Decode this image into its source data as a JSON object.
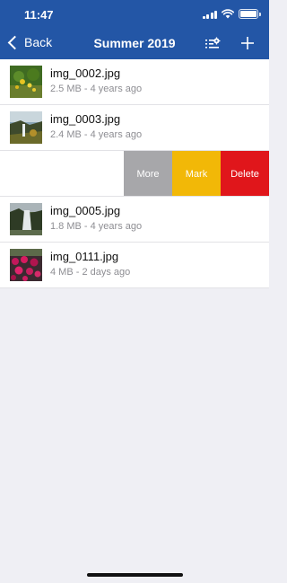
{
  "status_bar": {
    "time": "11:47"
  },
  "nav": {
    "back_label": "Back",
    "title": "Summer 2019",
    "settings_icon": "list-settings-icon",
    "add_icon": "plus-icon"
  },
  "colors": {
    "header": "#2356a6",
    "more": "#a7a7aa",
    "mark": "#f2b807",
    "delete": "#e0161b"
  },
  "files": [
    {
      "name": "img_0002.jpg",
      "meta": "2.5 MB - 4 years ago",
      "thumb": "yellow-flowers"
    },
    {
      "name": "img_0003.jpg",
      "meta": "2.4 MB - 4 years ago",
      "thumb": "waterfall-landscape"
    },
    {
      "name": "img_0005.jpg",
      "meta": "1.8 MB - 4 years ago",
      "thumb": "waterfall"
    },
    {
      "name": "img_0111.jpg",
      "meta": "4 MB - 2 days ago",
      "thumb": "pink-flowers"
    }
  ],
  "swipe_actions": {
    "more": "More",
    "mark": "Mark",
    "delete": "Delete"
  }
}
